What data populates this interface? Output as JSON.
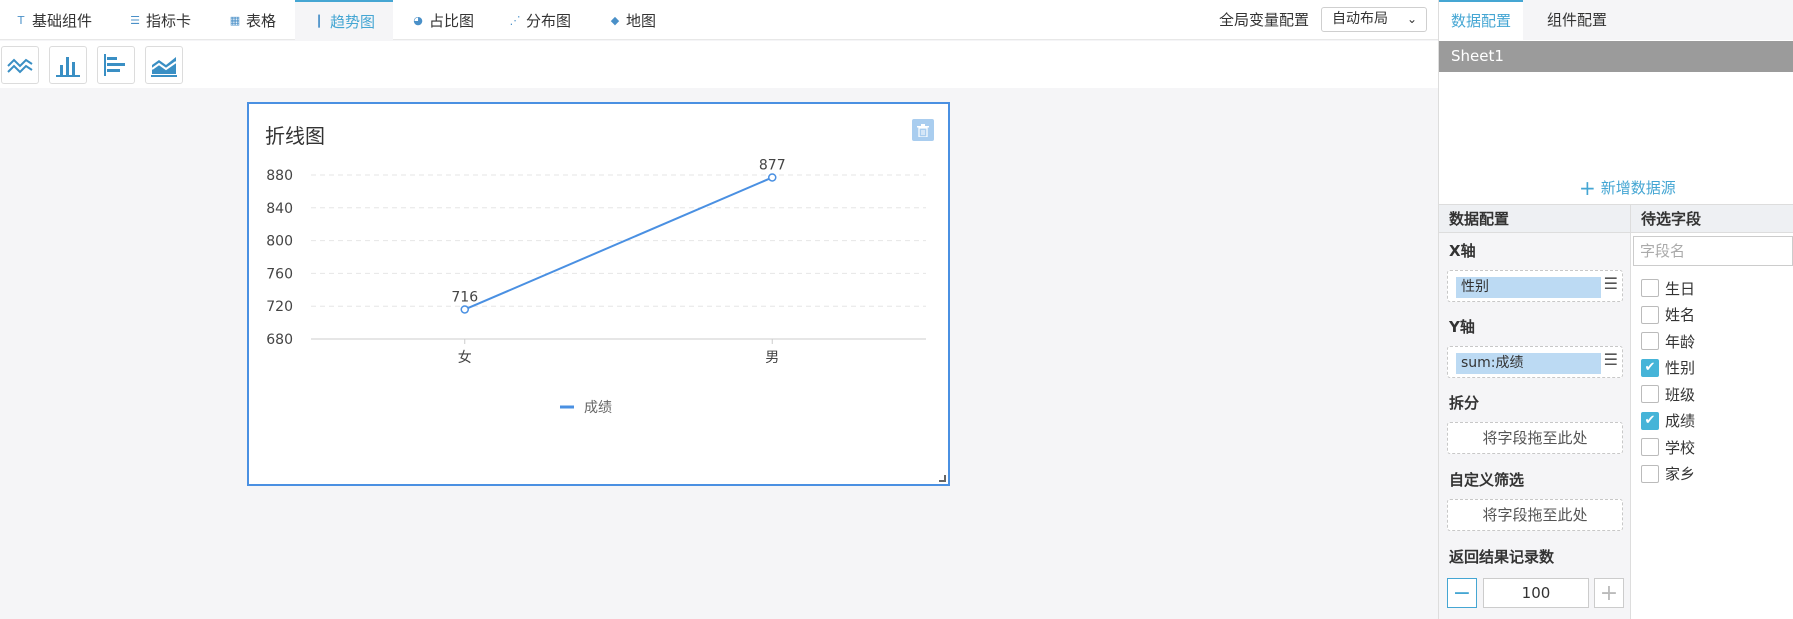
{
  "tabs": [
    {
      "label": "基础组件",
      "icon": "text-icon",
      "glyph": "T"
    },
    {
      "label": "指标卡",
      "icon": "card-icon",
      "glyph": "☰"
    },
    {
      "label": "表格",
      "icon": "table-icon",
      "glyph": "▦"
    },
    {
      "label": "趋势图",
      "icon": "bar-trend-icon",
      "glyph": "┃"
    },
    {
      "label": "占比图",
      "icon": "pie-icon",
      "glyph": "◕"
    },
    {
      "label": "分布图",
      "icon": "scatter-icon",
      "glyph": "⋰"
    },
    {
      "label": "地图",
      "icon": "map-icon",
      "glyph": "◆"
    }
  ],
  "active_tab": "趋势图",
  "header": {
    "global_var_label": "全局变量配置",
    "layout_value": "自动布局"
  },
  "chart_types": [
    "line-chart-icon",
    "column-chart-icon",
    "horizontal-bar-icon",
    "area-chart-icon"
  ],
  "widget": {
    "title": "折线图"
  },
  "chart_data": {
    "type": "line",
    "categories": [
      "女",
      "男"
    ],
    "series": [
      {
        "name": "成绩",
        "values": [
          716,
          877
        ],
        "color": "#4a90e2"
      }
    ],
    "ylim": [
      680,
      880
    ],
    "yticks": [
      680,
      720,
      760,
      800,
      840,
      880
    ],
    "data_labels": [
      "716",
      "877"
    ],
    "legend": "bottom-center",
    "grid": true
  },
  "right_panel": {
    "tabs": [
      "数据配置",
      "组件配置"
    ],
    "sheet": "Sheet1",
    "add_source": "新增数据源",
    "config_head": "数据配置",
    "fields_head": "待选字段",
    "x_axis_label": "X轴",
    "x_axis_field": "性别",
    "y_axis_label": "Y轴",
    "y_axis_field": "sum:成绩",
    "split_label": "拆分",
    "drop_hint": "将字段拖至此处",
    "filter_label": "自定义筛选",
    "limit_label": "返回结果记录数",
    "limit_value": "100",
    "field_search_placeholder": "字段名",
    "fields": [
      {
        "name": "生日",
        "checked": false
      },
      {
        "name": "姓名",
        "checked": false
      },
      {
        "name": "年龄",
        "checked": false
      },
      {
        "name": "性别",
        "checked": true
      },
      {
        "name": "班级",
        "checked": false
      },
      {
        "name": "成绩",
        "checked": true
      },
      {
        "name": "学校",
        "checked": false
      },
      {
        "name": "家乡",
        "checked": false
      }
    ]
  },
  "colors": {
    "accent": "#45a6d3",
    "line": "#4a90e2",
    "checkbox": "#45b4d8"
  }
}
